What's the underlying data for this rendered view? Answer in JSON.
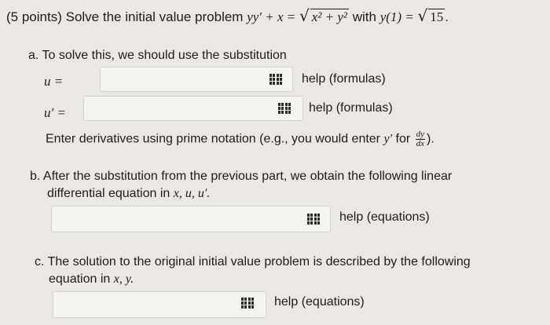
{
  "question": {
    "points": "(5 points)",
    "prompt": "Solve the initial value problem",
    "eq_lhs": "yy′ + x =",
    "eq_radicand": "x² + y²",
    "with_word": "with",
    "condition": "y(1) =",
    "cond_radicand": "15",
    "period": "."
  },
  "part_a": {
    "label": "a. To solve this, we should use the substitution",
    "u_label": "u =",
    "u_value": "",
    "u_help": "help (formulas)",
    "uprime_label": "u′ =",
    "uprime_value": "",
    "uprime_help": "help (formulas)",
    "note_prefix": "Enter derivatives using prime notation (e.g., you would enter",
    "note_var": "y′",
    "note_for": "for",
    "frac_num": "dy",
    "frac_den": "dx",
    "note_suffix": ")."
  },
  "part_b": {
    "label_line1": "b. After the substitution from the previous part, we obtain the following linear",
    "label_line2_text": "differential equation in",
    "label_line2_vars": "x, u, u′.",
    "value": "",
    "help": "help (equations)"
  },
  "part_c": {
    "label_line1": "c. The solution to the original initial value problem is described by the following",
    "label_line2_text": "equation in",
    "label_line2_vars": "x, y.",
    "value": "",
    "help": "help (equations)"
  },
  "icons": {
    "help_grid": "grid-icon"
  }
}
